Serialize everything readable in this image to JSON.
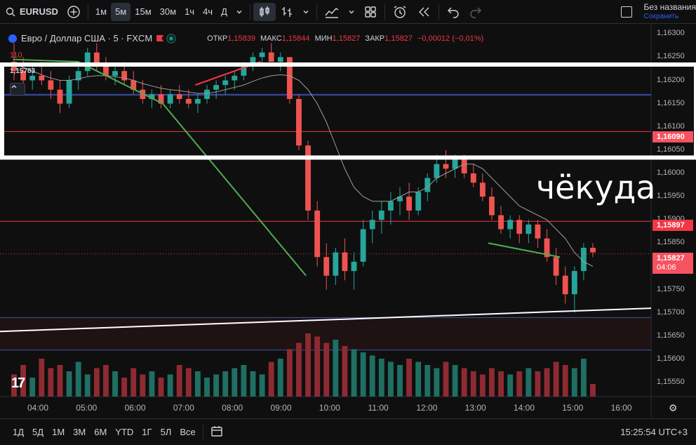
{
  "toolbar": {
    "symbol": "EURUSD",
    "intervals": [
      "1м",
      "5м",
      "15м",
      "30м",
      "1ч",
      "4ч",
      "Д"
    ],
    "active_interval": "5м",
    "save_title": "Без названия",
    "save_sub": "Сохранить"
  },
  "legend": {
    "title": "Евро / Доллар США · 5 · FXCM",
    "open_label": "ОТКР",
    "open": "1,15839",
    "high_label": "МАКС",
    "high": "1,15844",
    "low_label": "МИН",
    "low": "1,15827",
    "close_label": "ЗАКР",
    "close": "1,15827",
    "change": "−0,00012 (−0,01%)",
    "volume_label": "110",
    "last_value": "1,15783"
  },
  "annotation": "чёкуда",
  "price_axis": {
    "labels": [
      "1,16300",
      "1,16250",
      "1,16200",
      "1,16150",
      "1,16100",
      "1,16050",
      "1,16000",
      "1,15950",
      "1,15900",
      "1,15850",
      "1,15800",
      "1,15750",
      "1,15700",
      "1,15650",
      "1,15600",
      "1,15550"
    ],
    "tags": {
      "level_high": "1,16090",
      "level_mid": "1,15897",
      "current": "1,15827",
      "countdown": "04:06"
    }
  },
  "time_axis": [
    "04:00",
    "05:00",
    "06:00",
    "07:00",
    "08:00",
    "09:00",
    "10:00",
    "11:00",
    "12:00",
    "13:00",
    "14:00",
    "15:00",
    "16:00"
  ],
  "bottombar": {
    "ranges": [
      "1Д",
      "5Д",
      "1М",
      "3М",
      "6М",
      "YTD",
      "1Г",
      "5Л",
      "Все"
    ],
    "clock": "15:25:54 UTC+3"
  },
  "chart_data": {
    "type": "candlestick",
    "ylim": [
      1.1552,
      1.1632
    ],
    "horizontal_levels": [
      1.16168,
      1.1617,
      1.1609,
      1.15897,
      1.1569,
      1.1562
    ],
    "candles": [
      [
        1.1624,
        1.1628,
        1.162,
        1.1622
      ],
      [
        1.1622,
        1.1625,
        1.1619,
        1.162
      ],
      [
        1.162,
        1.1623,
        1.1618,
        1.1621
      ],
      [
        1.1621,
        1.1624,
        1.1619,
        1.162
      ],
      [
        1.162,
        1.1622,
        1.1616,
        1.1618
      ],
      [
        1.1618,
        1.162,
        1.1613,
        1.1615
      ],
      [
        1.1615,
        1.1621,
        1.1614,
        1.162
      ],
      [
        1.162,
        1.1624,
        1.1618,
        1.1622
      ],
      [
        1.1622,
        1.1627,
        1.1621,
        1.1626
      ],
      [
        1.1626,
        1.1628,
        1.1622,
        1.1623
      ],
      [
        1.1623,
        1.1625,
        1.162,
        1.1621
      ],
      [
        1.1621,
        1.1623,
        1.1619,
        1.1622
      ],
      [
        1.1622,
        1.1624,
        1.1619,
        1.162
      ],
      [
        1.162,
        1.1622,
        1.1617,
        1.1618
      ],
      [
        1.1618,
        1.162,
        1.1615,
        1.1616
      ],
      [
        1.1616,
        1.1618,
        1.1614,
        1.1617
      ],
      [
        1.1617,
        1.1619,
        1.1614,
        1.1615
      ],
      [
        1.1615,
        1.1618,
        1.1614,
        1.1617
      ],
      [
        1.1617,
        1.1619,
        1.1615,
        1.1616
      ],
      [
        1.1616,
        1.1618,
        1.1614,
        1.1615
      ],
      [
        1.1615,
        1.1617,
        1.1613,
        1.1616
      ],
      [
        1.1616,
        1.1619,
        1.1615,
        1.1618
      ],
      [
        1.1618,
        1.162,
        1.1616,
        1.1619
      ],
      [
        1.1619,
        1.1621,
        1.1617,
        1.162
      ],
      [
        1.162,
        1.1622,
        1.1618,
        1.1621
      ],
      [
        1.1621,
        1.1624,
        1.162,
        1.1623
      ],
      [
        1.1623,
        1.1626,
        1.1622,
        1.1625
      ],
      [
        1.1625,
        1.1627,
        1.1623,
        1.1626
      ],
      [
        1.1626,
        1.1628,
        1.1624,
        1.1624
      ],
      [
        1.1624,
        1.1626,
        1.1622,
        1.1625
      ],
      [
        1.1625,
        1.1625,
        1.1615,
        1.1616
      ],
      [
        1.1616,
        1.1617,
        1.1605,
        1.1606
      ],
      [
        1.1606,
        1.1607,
        1.159,
        1.1592
      ],
      [
        1.1592,
        1.1594,
        1.158,
        1.1582
      ],
      [
        1.1582,
        1.1585,
        1.1575,
        1.1578
      ],
      [
        1.1578,
        1.1584,
        1.1576,
        1.1583
      ],
      [
        1.1583,
        1.1586,
        1.1577,
        1.1579
      ],
      [
        1.1579,
        1.1583,
        1.1575,
        1.1581
      ],
      [
        1.1581,
        1.159,
        1.158,
        1.1588
      ],
      [
        1.1588,
        1.1592,
        1.1585,
        1.159
      ],
      [
        1.159,
        1.1594,
        1.1587,
        1.1592
      ],
      [
        1.1592,
        1.1596,
        1.1589,
        1.1594
      ],
      [
        1.1594,
        1.1597,
        1.1591,
        1.1595
      ],
      [
        1.1595,
        1.1598,
        1.159,
        1.1592
      ],
      [
        1.1592,
        1.1597,
        1.1591,
        1.1596
      ],
      [
        1.1596,
        1.16,
        1.1594,
        1.1599
      ],
      [
        1.1599,
        1.1604,
        1.1598,
        1.1602
      ],
      [
        1.1602,
        1.1605,
        1.1599,
        1.1601
      ],
      [
        1.1601,
        1.1604,
        1.1599,
        1.1603
      ],
      [
        1.1603,
        1.1604,
        1.1599,
        1.16
      ],
      [
        1.16,
        1.1602,
        1.1597,
        1.1598
      ],
      [
        1.1598,
        1.16,
        1.1594,
        1.1595
      ],
      [
        1.1595,
        1.1597,
        1.159,
        1.1591
      ],
      [
        1.1591,
        1.1593,
        1.1587,
        1.1588
      ],
      [
        1.1588,
        1.1591,
        1.1586,
        1.159
      ],
      [
        1.159,
        1.1591,
        1.1585,
        1.1587
      ],
      [
        1.1587,
        1.159,
        1.1585,
        1.1589
      ],
      [
        1.1589,
        1.159,
        1.1584,
        1.1586
      ],
      [
        1.1586,
        1.1588,
        1.1581,
        1.1582
      ],
      [
        1.1582,
        1.1584,
        1.1576,
        1.1578
      ],
      [
        1.1578,
        1.158,
        1.1572,
        1.1574
      ],
      [
        1.1574,
        1.158,
        1.157,
        1.1579
      ],
      [
        1.1579,
        1.1585,
        1.1577,
        1.1584
      ],
      [
        1.1584,
        1.1585,
        1.1582,
        1.1583
      ]
    ],
    "ma": [
      1.16235,
      1.16228,
      1.1622,
      1.16212,
      1.16205,
      1.162,
      1.162,
      1.16203,
      1.16208,
      1.1621,
      1.1621,
      1.16208,
      1.16205,
      1.162,
      1.16193,
      1.16188,
      1.16183,
      1.1618,
      1.16178,
      1.16175,
      1.16172,
      1.16172,
      1.16175,
      1.1618,
      1.16185,
      1.1619,
      1.16198,
      1.16205,
      1.1621,
      1.16212,
      1.1621,
      1.162,
      1.1618,
      1.1615,
      1.1611,
      1.1606,
      1.1601,
      1.1597,
      1.1595,
      1.1594,
      1.1594,
      1.1594,
      1.1595,
      1.1596,
      1.1596,
      1.1597,
      1.1599,
      1.16,
      1.1601,
      1.1602,
      1.1602,
      1.1601,
      1.1599,
      1.1597,
      1.1595,
      1.1593,
      1.1592,
      1.1591,
      1.159,
      1.1588,
      1.1586,
      1.1583,
      1.1581,
      1.158
    ],
    "volumes": [
      0.35,
      0.5,
      0.3,
      0.6,
      0.45,
      0.5,
      0.4,
      0.55,
      0.35,
      0.45,
      0.5,
      0.4,
      0.3,
      0.45,
      0.35,
      0.4,
      0.3,
      0.35,
      0.5,
      0.45,
      0.4,
      0.3,
      0.35,
      0.4,
      0.45,
      0.5,
      0.4,
      0.35,
      0.55,
      0.6,
      0.75,
      0.85,
      1.0,
      0.95,
      0.85,
      0.9,
      0.8,
      0.75,
      0.7,
      0.65,
      0.6,
      0.55,
      0.5,
      0.6,
      0.55,
      0.5,
      0.45,
      0.55,
      0.5,
      0.45,
      0.4,
      0.35,
      0.45,
      0.4,
      0.35,
      0.4,
      0.45,
      0.4,
      0.45,
      0.55,
      0.5,
      0.45,
      0.6,
      0.2
    ],
    "trend_lines": [
      {
        "color": "#4caf50",
        "points": [
          [
            0.02,
            1.16245
          ],
          [
            0.12,
            1.1624
          ],
          [
            0.25,
            1.1615
          ],
          [
            0.47,
            1.1578
          ]
        ]
      },
      {
        "color": "#f23645",
        "points": [
          [
            0.3,
            1.1619
          ],
          [
            0.4,
            1.1624
          ]
        ]
      },
      {
        "color": "#4caf50",
        "points": [
          [
            0.75,
            1.1585
          ],
          [
            0.86,
            1.1582
          ]
        ]
      },
      {
        "color": "#ffffff",
        "points": [
          [
            0.0,
            1.1566
          ],
          [
            1.0,
            1.1571
          ]
        ]
      }
    ]
  }
}
